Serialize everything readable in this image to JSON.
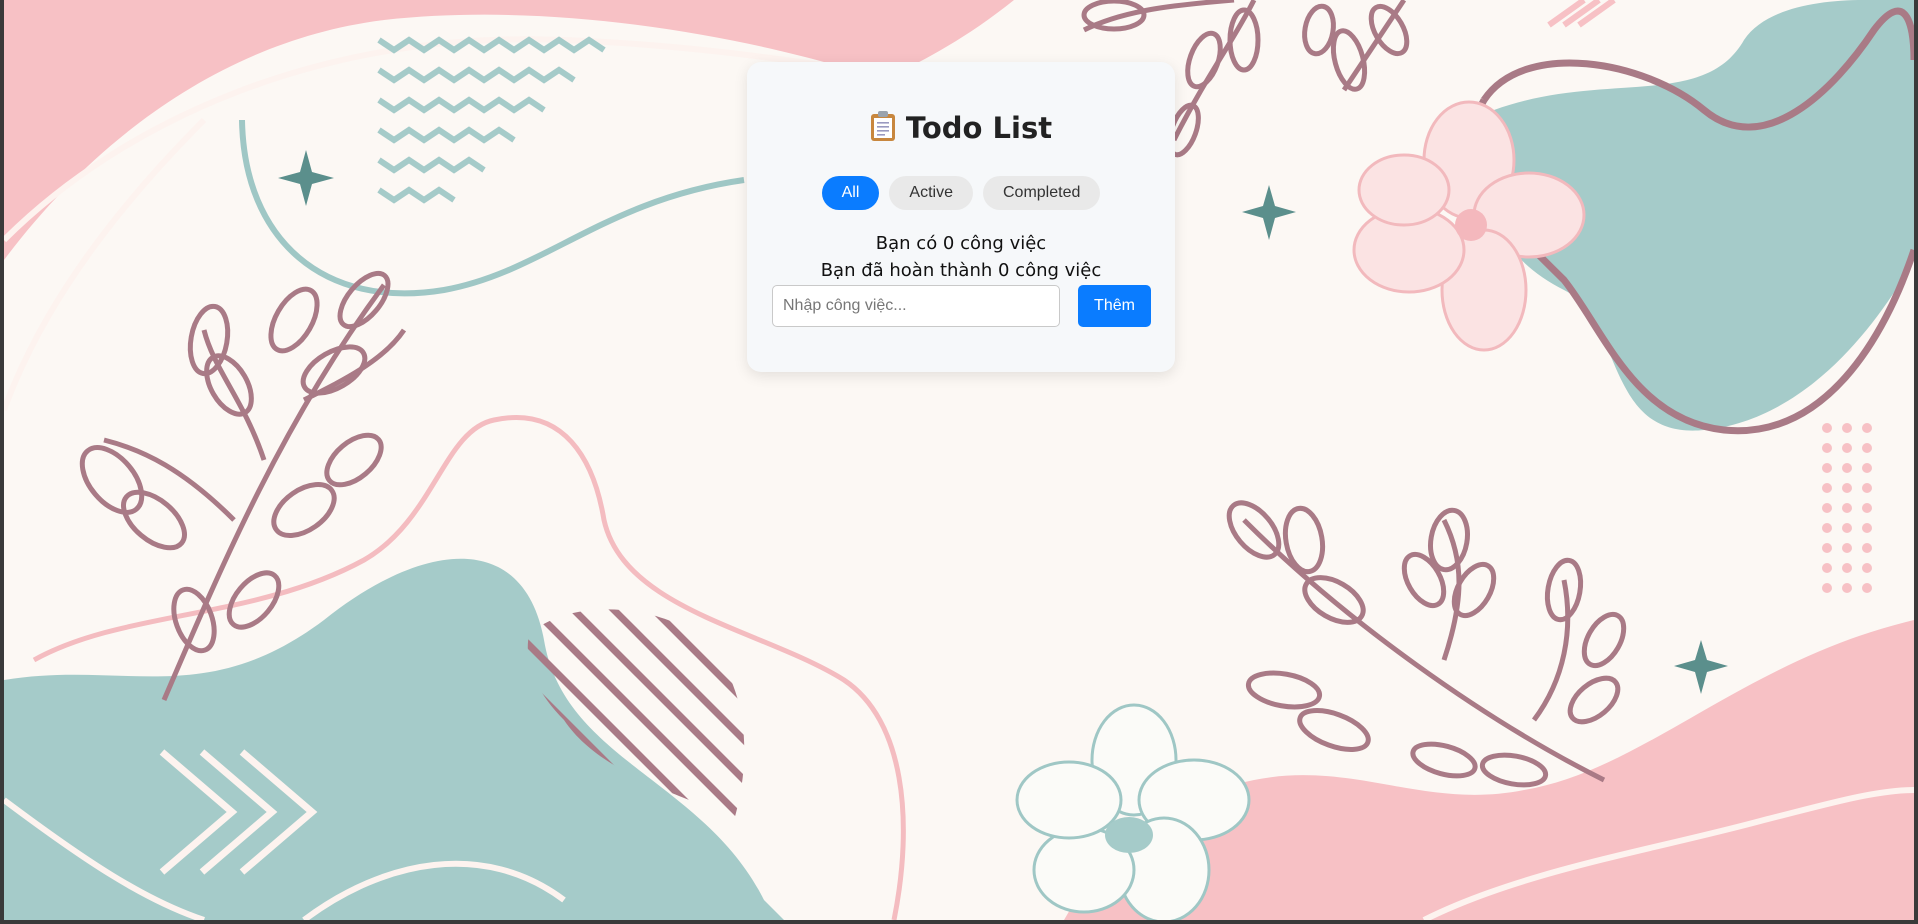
{
  "app": {
    "title": "Todo List",
    "title_icon": "clipboard-icon"
  },
  "filters": [
    {
      "label": "All",
      "active": true
    },
    {
      "label": "Active",
      "active": false
    },
    {
      "label": "Completed",
      "active": false
    }
  ],
  "stats": {
    "total_text": "Bạn có 0 công việc",
    "completed_text": "Bạn đã hoàn thành 0 công việc"
  },
  "form": {
    "input_value": "",
    "input_placeholder": "Nhập công việc...",
    "add_label": "Thêm"
  },
  "colors": {
    "accent": "#0a7cff",
    "card": "#f6f8fa",
    "bg_pink": "#f7c1c5",
    "bg_teal": "#a5cbc9",
    "bg_mauve": "#a97a86",
    "bg_cream": "#fcf8f4"
  }
}
